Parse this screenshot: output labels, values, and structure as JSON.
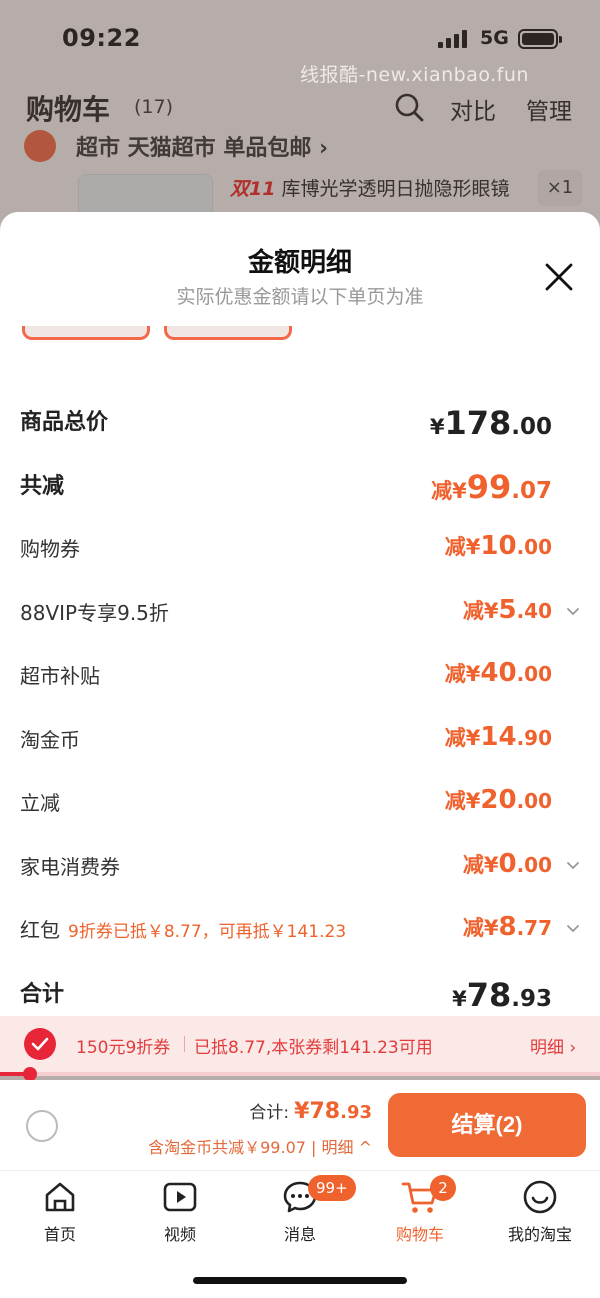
{
  "status_bar": {
    "time": "09:22",
    "network": "5G"
  },
  "watermark": "线报酷-new.xianbao.fun",
  "cart_header": {
    "title": "购物车",
    "count": "(17)",
    "compare": "对比",
    "manage": "管理"
  },
  "background_store": {
    "store_name": "超市 天猫超市 单品包邮 ›",
    "product_tag": "双11",
    "product_name": "库博光学透明日抛隐形眼镜",
    "quantity": "×1"
  },
  "sheet": {
    "title": "金额明细",
    "subtitle": "实际优惠金额请以下单页为准",
    "rows": [
      {
        "label": "商品总价",
        "prefix": "¥",
        "int": "178",
        "frac": ".00",
        "kind": "total"
      },
      {
        "label": "共减",
        "prefix": "减¥",
        "int": "99",
        "frac": ".07",
        "kind": "reduce"
      },
      {
        "label": "购物券",
        "prefix": "减¥",
        "int": "10",
        "frac": ".00"
      },
      {
        "label": "88VIP专享9.5折",
        "prefix": "减¥",
        "int": "5",
        "frac": ".40",
        "chevron": true
      },
      {
        "label": "超市补贴",
        "prefix": "减¥",
        "int": "40",
        "frac": ".00"
      },
      {
        "label": "淘金币",
        "prefix": "减¥",
        "int": "14",
        "frac": ".90"
      },
      {
        "label": "立减",
        "prefix": "减¥",
        "int": "20",
        "frac": ".00"
      },
      {
        "label": "家电消费券",
        "prefix": "减¥",
        "int": "0",
        "frac": ".00",
        "chevron": true
      },
      {
        "label": "红包",
        "note": "9折券已抵￥8.77，可再抵￥141.23",
        "prefix": "减¥",
        "int": "8",
        "frac": ".77",
        "chevron": true
      },
      {
        "label": "合计",
        "prefix": "¥",
        "int": "78",
        "frac": ".93",
        "kind": "total"
      }
    ]
  },
  "coupon_bar": {
    "name": "150元9折券",
    "info": "已抵8.77,本张券剩141.23可用",
    "detail": "明细 ›",
    "progress": 0.05
  },
  "checkout": {
    "sum_label": "合计:",
    "sum_prefix": "¥",
    "sum_int": "78",
    "sum_frac": ".93",
    "sub": "含淘金币共减￥99.07 | 明细 ^",
    "button": "结算(2)"
  },
  "tabs": [
    {
      "label": "首页",
      "icon": "home-icon"
    },
    {
      "label": "视频",
      "icon": "video-icon"
    },
    {
      "label": "消息",
      "icon": "message-icon",
      "badge": "99+"
    },
    {
      "label": "购物车",
      "icon": "cart-icon",
      "badge": "2",
      "active": true
    },
    {
      "label": "我的淘宝",
      "icon": "profile-icon"
    }
  ],
  "colors": {
    "accent": "#f0622d",
    "coupon_red": "#e8263a",
    "background": "#ffffff"
  }
}
